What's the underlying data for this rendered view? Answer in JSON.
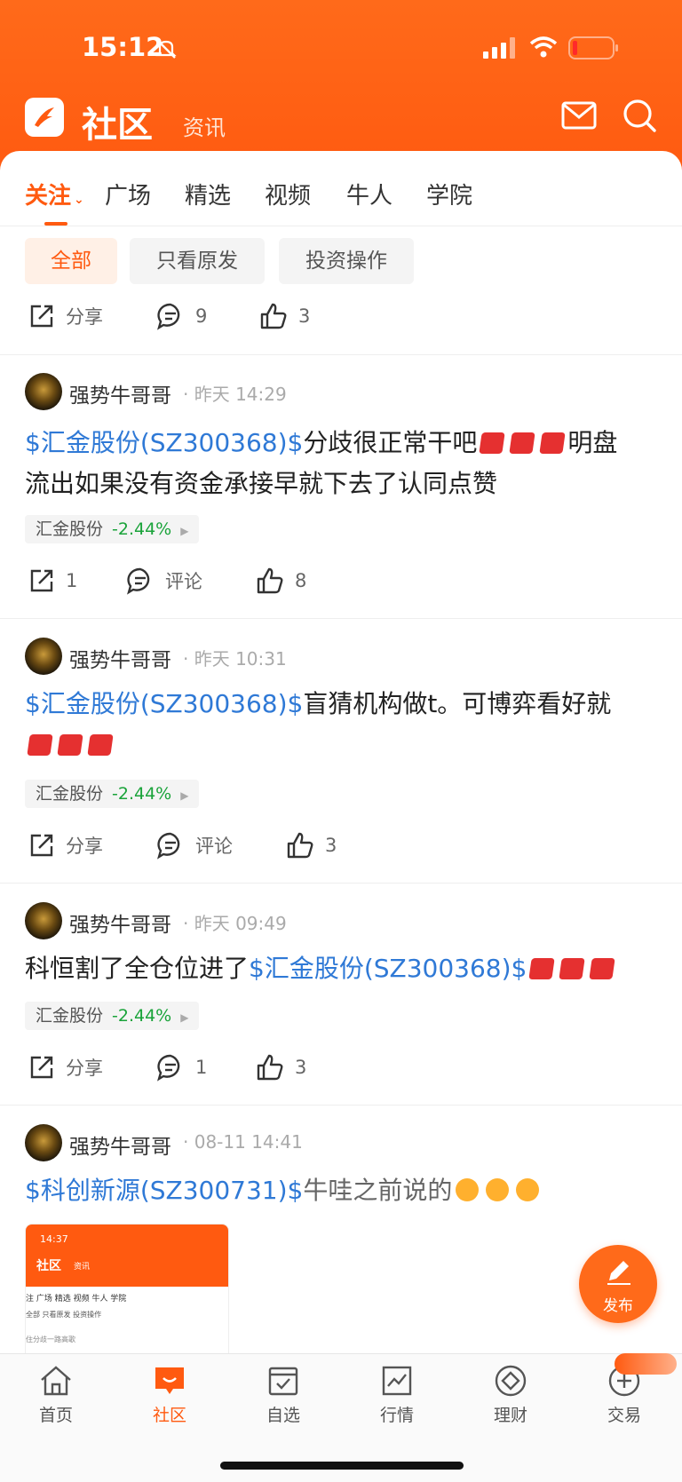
{
  "status_bar": {
    "time": "15:12"
  },
  "header": {
    "title": "社区",
    "subtitle": "资讯"
  },
  "tabs": [
    {
      "label": "关注"
    },
    {
      "label": "广场"
    },
    {
      "label": "精选"
    },
    {
      "label": "视频"
    },
    {
      "label": "牛人"
    },
    {
      "label": "学院"
    }
  ],
  "filters": [
    {
      "label": "全部"
    },
    {
      "label": "只看原发"
    },
    {
      "label": "投资操作"
    }
  ],
  "top_actions": {
    "share": "分享",
    "comments": "9",
    "likes": "3"
  },
  "posts": [
    {
      "user": "强势牛哥哥",
      "time": "· 昨天 14:29",
      "stock_link": "$汇金股份(SZ300368)$",
      "text": "分歧很正常干吧",
      "text2": "明盘",
      "text3": "流出如果没有资金承接早就下去了认同点赞",
      "tag_name": "汇金股份",
      "tag_change": "-2.44%",
      "share": "1",
      "comments": "评论",
      "likes": "8"
    },
    {
      "user": "强势牛哥哥",
      "time": "· 昨天 10:31",
      "stock_link": "$汇金股份(SZ300368)$",
      "text": "盲猜机构做t。可博弈看好就",
      "tag_name": "汇金股份",
      "tag_change": "-2.44%",
      "share": "分享",
      "comments": "评论",
      "likes": "3"
    },
    {
      "user": "强势牛哥哥",
      "time": "· 昨天 09:49",
      "text": "科恒割了全仓位进了",
      "stock_link": "$汇金股份(SZ300368)$",
      "tag_name": "汇金股份",
      "tag_change": "-2.44%",
      "share": "分享",
      "comments": "1",
      "likes": "3"
    },
    {
      "user": "强势牛哥哥",
      "time": "· 08-11 14:41",
      "stock_link": "$科创新源(SZ300731)$",
      "text": "牛哇之前说的"
    }
  ],
  "thumbnail": {
    "time": "14:37",
    "title": "社区",
    "subtitle": "资讯",
    "tabs": "注 广场  精选  视频  牛人  学院",
    "chips": "全部   只看原发   投资操作",
    "line": "住分歧一路高歌"
  },
  "fab": {
    "label": "发布"
  },
  "bottom_nav": [
    {
      "label": "首页"
    },
    {
      "label": "社区"
    },
    {
      "label": "自选"
    },
    {
      "label": "行情"
    },
    {
      "label": "理财"
    },
    {
      "label": "交易"
    }
  ],
  "colors": {
    "brand": "#ff5a10",
    "link": "#2f79d6",
    "down": "#1aa33a"
  }
}
